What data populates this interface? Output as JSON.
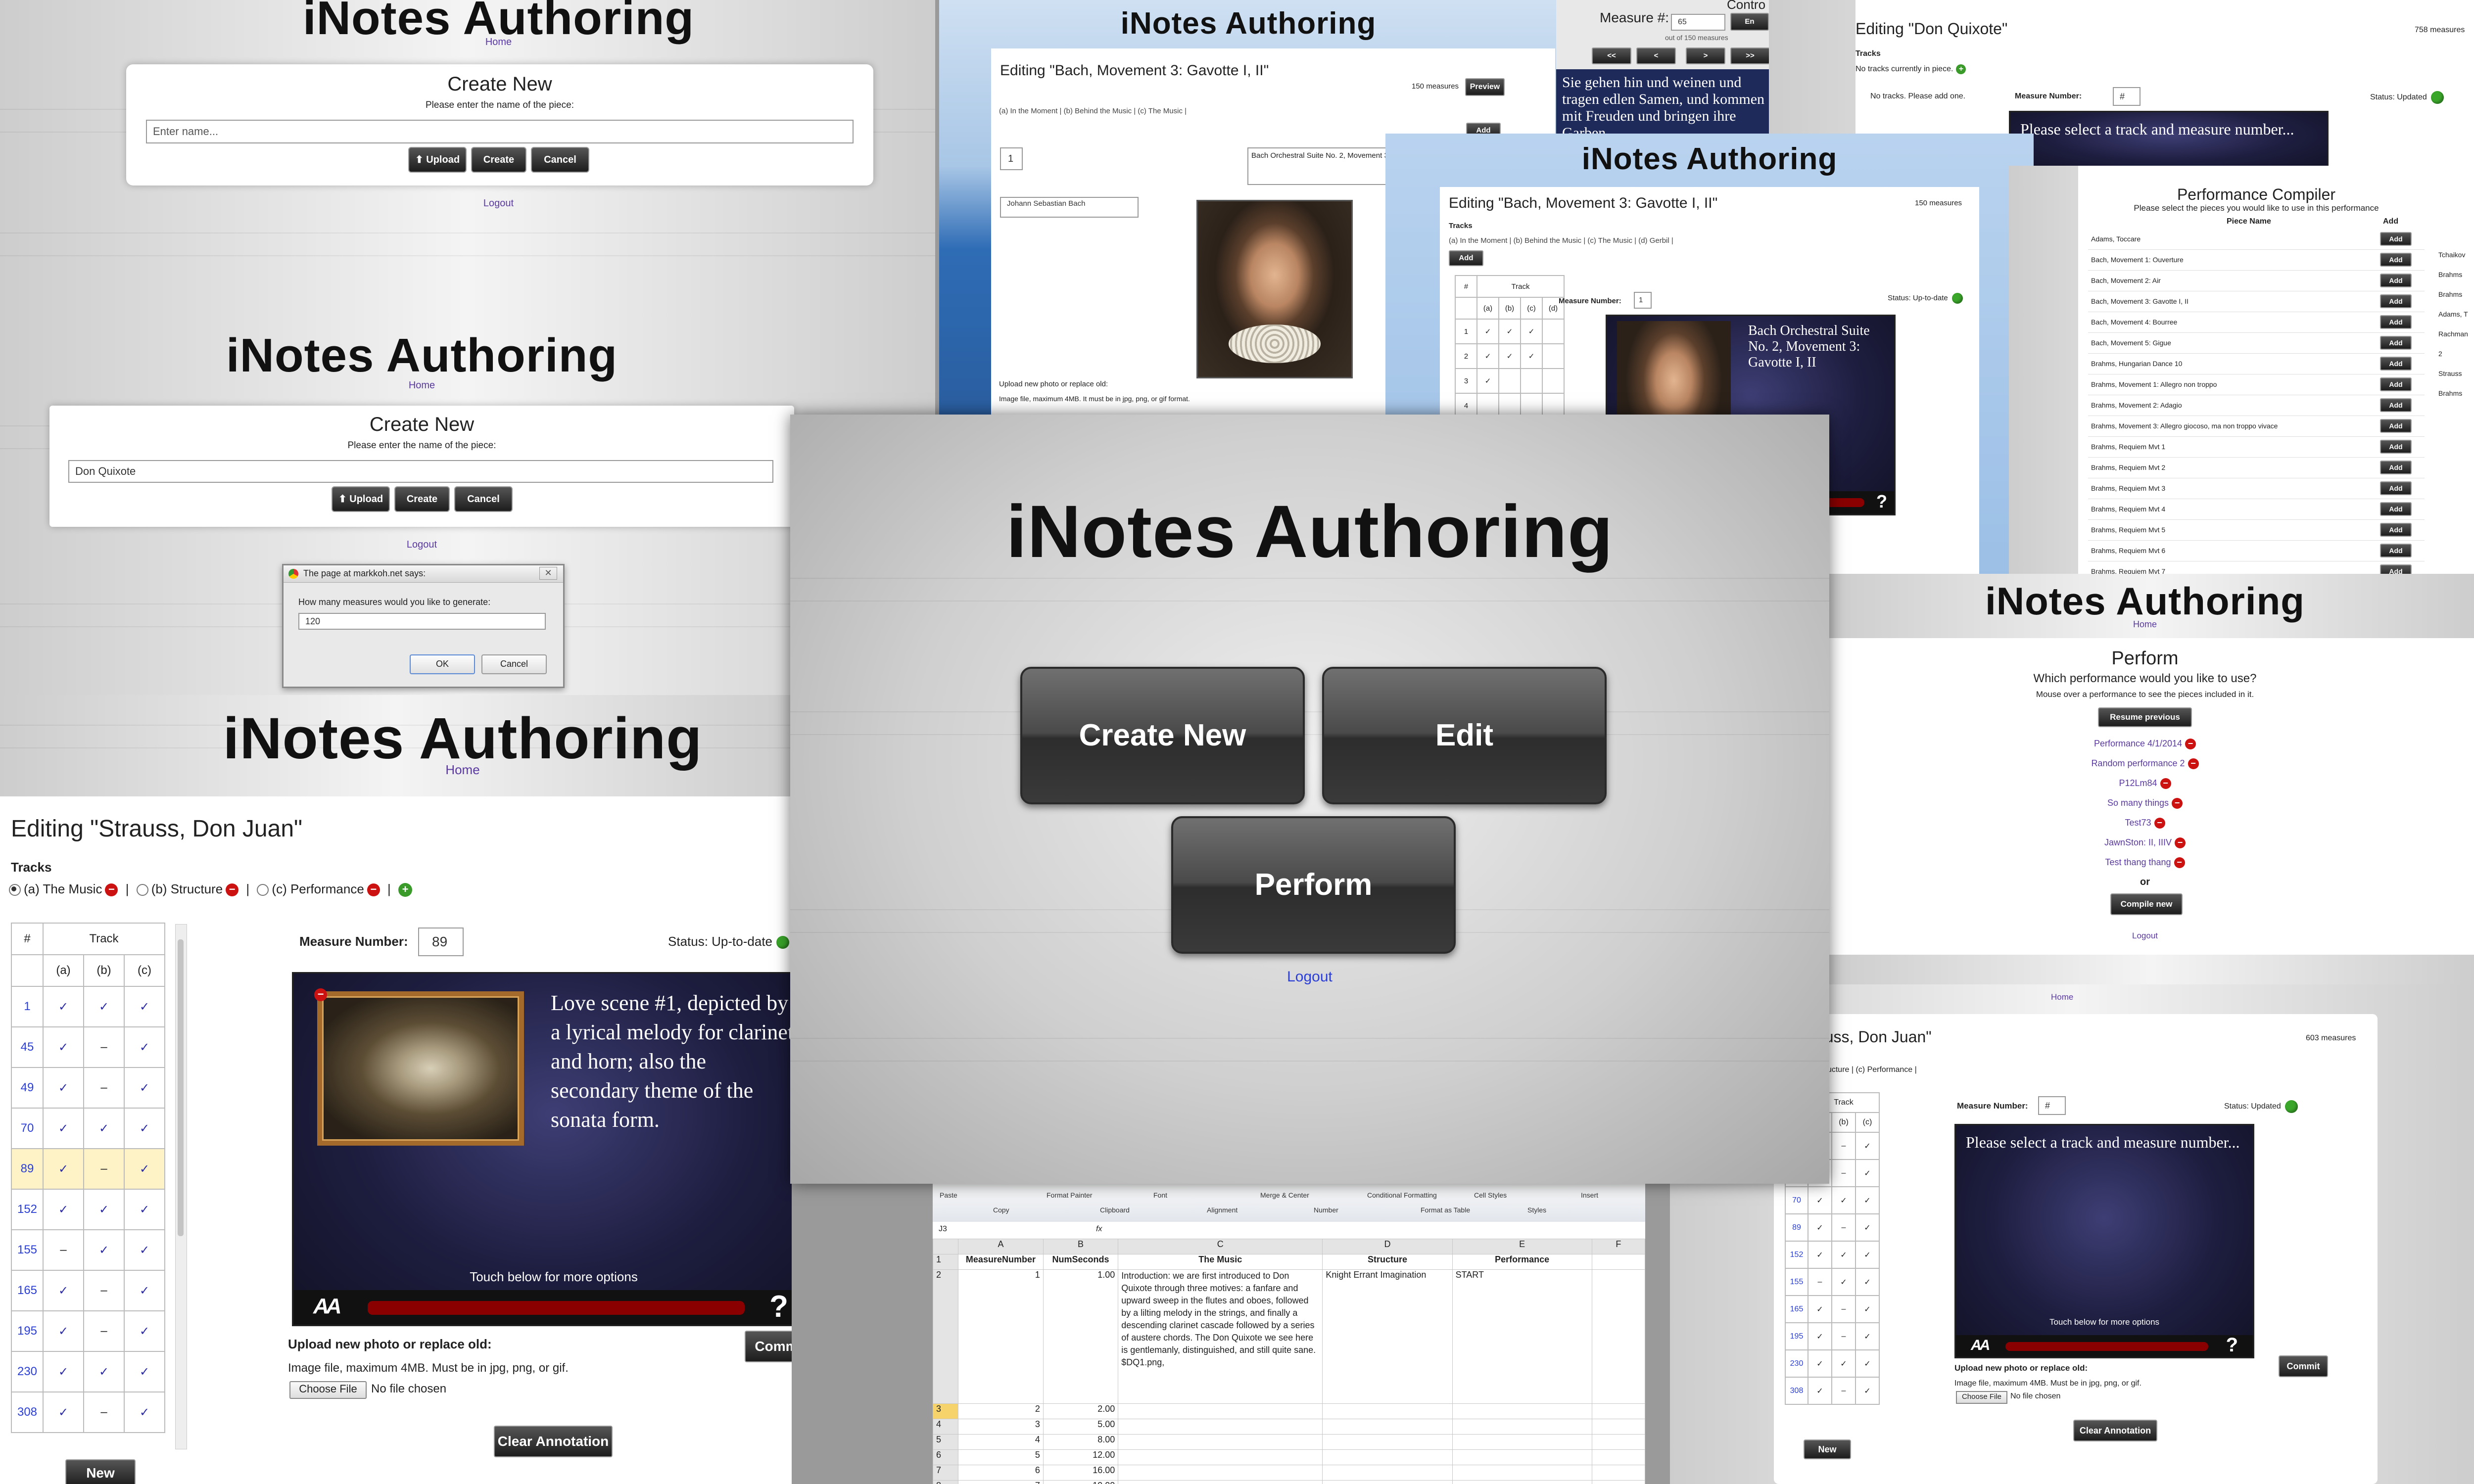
{
  "app_title": "iNotes Authoring",
  "home_link": "Home",
  "logout_link": "Logout",
  "hero": {
    "title": "iNotes Authoring",
    "create_label": "Create New",
    "edit_label": "Edit",
    "perform_label": "Perform",
    "logout": "Logout"
  },
  "create1": {
    "heading": "Create New",
    "prompt": "Please enter the name of the piece:",
    "placeholder": "Enter name...",
    "upload": "⬆ Upload",
    "create": "Create",
    "cancel": "Cancel",
    "logout": "Logout"
  },
  "create2": {
    "heading": "Create New",
    "prompt": "Please enter the name of the piece:",
    "value": "Don Quixote",
    "upload": "⬆ Upload",
    "create": "Create",
    "cancel": "Cancel",
    "logout": "Logout"
  },
  "dialog": {
    "title": "The page at markkoh.net says:",
    "question": "How many measures would you like to generate:",
    "value": "120",
    "ok": "OK",
    "cancel": "Cancel"
  },
  "bach_edit": {
    "heading": "Editing \"Bach, Movement 3: Gavotte I, II\"",
    "measures": "150 measures",
    "preview": "Preview",
    "tracks": "(a) In the Moment | (b) Behind the Music | (c) The Music |",
    "add": "Add",
    "measure_box": "1",
    "annotation_text": "Bach Orchestral Suite No. 2, Movement 3: Gavotte I, II",
    "composer": "Johann Sebastian Bach",
    "upload_label": "Upload new photo or replace old:",
    "upload_hint": "Image file, maximum 4MB. It must be in jpg, png, or gif format."
  },
  "controls": {
    "label": "Measure #:",
    "value": "65",
    "of_text": "out of 150 measures",
    "top_label": "Contro",
    "btn_en": "En",
    "first": "<<",
    "prev": "<",
    "next": ">",
    "last": ">>",
    "lyric": "Sie gehen hin und weinen und tragen edlen Samen, und kommen mit Freuden und bringen ihre Garben."
  },
  "bach_edit2": {
    "title": "iNotes Authoring",
    "heading": "Editing \"Bach, Movement 3: Gavotte I, II\"",
    "measures": "150 measures",
    "tracks_label": "Tracks",
    "tracks": "(a) In the Moment | (b) Behind the Music | (c) The Music | (d) Gerbil |",
    "add": "Add",
    "measure_label": "Measure Number:",
    "measure_value": "1",
    "status": "Status: Up-to-date",
    "track_header": "Track",
    "cols": [
      "#",
      "(a)",
      "(b)",
      "(c)",
      "(d)"
    ],
    "rows": [
      [
        "1",
        "✓",
        "✓",
        "✓",
        ""
      ],
      [
        "2",
        "✓",
        "✓",
        "✓",
        ""
      ],
      [
        "3",
        "✓",
        "",
        "",
        ""
      ],
      [
        "4",
        "",
        "",
        "",
        ""
      ]
    ],
    "annotation_text": "Bach Orchestral Suite No. 2, Movement 3: Gavotte I, II"
  },
  "quixote_edit": {
    "heading": "Editing \"Don Quixote\"",
    "measures": "758 measures",
    "tracks_label": "Tracks",
    "no_tracks": "No tracks currently in piece.",
    "no_tracks2": "No tracks. Please add one.",
    "measure_label": "Measure Number:",
    "measure_value": "#",
    "status": "Status: Updated",
    "select_msg": "Please select a track and measure number..."
  },
  "compiler": {
    "title": "Performance Compiler",
    "subtitle": "Please select the pieces you would like to use in this performance",
    "col_piece": "Piece Name",
    "col_add": "Add",
    "add_label": "Add",
    "pieces": [
      "Adams, Toccare",
      "Bach, Movement 1: Ouverture",
      "Bach, Movement 2: Air",
      "Bach, Movement 3: Gavotte I, II",
      "Bach, Movement 4: Bourree",
      "Bach, Movement 5: Gigue",
      "Brahms, Hungarian Dance 10",
      "Brahms, Movement 1: Allegro non troppo",
      "Brahms, Movement 2: Adagio",
      "Brahms, Movement 3: Allegro giocoso, ma non troppo vivace",
      "Brahms, Requiem Mvt 1",
      "Brahms, Requiem Mvt 2",
      "Brahms, Requiem Mvt 3",
      "Brahms, Requiem Mvt 4",
      "Brahms, Requiem Mvt 5",
      "Brahms, Requiem Mvt 6",
      "Brahms, Requiem Mvt 7"
    ],
    "side_list": [
      "Tchaikov",
      "Brahms",
      "Brahms",
      "Adams, T",
      "Rachman",
      "2",
      "Strauss",
      "Brahms"
    ]
  },
  "perform": {
    "title": "iNotes Authoring",
    "home": "Home",
    "heading": "Perform",
    "question": "Which performance would you like to use?",
    "hint": "Mouse over a performance to see the pieces included in it.",
    "resume": "Resume previous",
    "performances": [
      "Performance 4/1/2014",
      "Random performance 2",
      "P12Lm84",
      "So many things",
      "Test73",
      "JawnSton: II, IIIV",
      "Test thang thang"
    ],
    "or": "or",
    "compile": "Compile new",
    "logout": "Logout"
  },
  "strauss_edit": {
    "title": "iNotes Authoring",
    "home": "Home",
    "heading": "Editing \"Strauss, Don Juan\"",
    "tracks_label": "Tracks",
    "track_a": "(a) The Music",
    "track_b": "(b) Structure",
    "track_c": "(c) Performance",
    "sep": "|",
    "track_header": "Track",
    "cols": [
      "#",
      "(a)",
      "(b)",
      "(c)"
    ],
    "rows": [
      [
        "1",
        "✓",
        "✓",
        "✓"
      ],
      [
        "45",
        "✓",
        "–",
        "✓"
      ],
      [
        "49",
        "✓",
        "–",
        "✓"
      ],
      [
        "70",
        "✓",
        "✓",
        "✓"
      ],
      [
        "89",
        "✓",
        "–",
        "✓"
      ],
      [
        "152",
        "✓",
        "✓",
        "✓"
      ],
      [
        "155",
        "–",
        "✓",
        "✓"
      ],
      [
        "165",
        "✓",
        "–",
        "✓"
      ],
      [
        "195",
        "✓",
        "–",
        "✓"
      ],
      [
        "230",
        "✓",
        "✓",
        "✓"
      ],
      [
        "308",
        "✓",
        "–",
        "✓"
      ]
    ],
    "highlight_row": "89",
    "measure_label": "Measure Number:",
    "measure_value": "89",
    "status": "Status: Up-to-date",
    "annotation_text": "Love scene #1, depicted by a lyrical melody for clarinet and horn; also the secondary theme of the sonata form.",
    "touch_hint": "Touch below for more options",
    "font_icon": "AA",
    "help_icon": "?",
    "upload_label": "Upload new photo or replace old:",
    "upload_hint": "Image file, maximum 4MB. Must be in jpg, png, or gif.",
    "choose_file": "Choose File",
    "no_file": "No file chosen",
    "commit": "Commit",
    "clear": "Clear Annotation",
    "new_btn": "New"
  },
  "spreadsheet": {
    "cell_ref": "J3",
    "fx": "fx",
    "ribbon": [
      "Paste",
      "Copy",
      "Format Painter",
      "Clipboard",
      "Font",
      "Alignment",
      "Merge & Center",
      "Number",
      "Conditional Formatting",
      "Format as Table",
      "Cell Styles",
      "Styles",
      "Insert"
    ],
    "col_letters": [
      "A",
      "B",
      "C",
      "D",
      "E",
      "F"
    ],
    "headers": [
      "MeasureNumber",
      "NumSeconds",
      "The Music",
      "Structure",
      "Performance"
    ],
    "row2": {
      "measure": "1",
      "seconds": "1.00",
      "music": "Introduction: we are first introduced to Don Quixote through three motives: a fanfare and upward sweep in the flutes and oboes, followed by a lilting melody in the strings, and finally a descending clarinet cascade followed by a series of austere chords. The Don Quixote we see here is gentlemanly, distinguished, and still quite sane. $DQ1.png,",
      "structure": "Knight Errant Imagination",
      "performance": "START"
    },
    "rows": [
      [
        "3",
        "2",
        "2.00"
      ],
      [
        "4",
        "3",
        "5.00"
      ],
      [
        "5",
        "4",
        "8.00"
      ],
      [
        "6",
        "5",
        "12.00"
      ],
      [
        "7",
        "6",
        "16.00"
      ],
      [
        "8",
        "7",
        "19.00"
      ]
    ]
  },
  "strauss_small": {
    "home": "Home",
    "heading": "g \"Strauss, Don Juan\"",
    "measures": "603 measures",
    "tracks": "usic  | (b) Structure  | (c) Performance  |",
    "track_header": "Track",
    "cols": [
      "(b)",
      "(c)"
    ],
    "rows": [
      [
        "45",
        "✓",
        "–",
        "✓"
      ],
      [
        "49",
        "✓",
        "–",
        "✓"
      ],
      [
        "70",
        "✓",
        "✓",
        "✓"
      ],
      [
        "89",
        "✓",
        "–",
        "✓"
      ],
      [
        "152",
        "✓",
        "✓",
        "✓"
      ],
      [
        "155",
        "–",
        "✓",
        "✓"
      ],
      [
        "165",
        "✓",
        "–",
        "✓"
      ],
      [
        "195",
        "✓",
        "–",
        "✓"
      ],
      [
        "230",
        "✓",
        "✓",
        "✓"
      ],
      [
        "308",
        "✓",
        "–",
        "✓"
      ]
    ],
    "measure_label": "Measure Number:",
    "measure_value": "#",
    "status": "Status: Updated",
    "select_msg": "Please select a track and measure number...",
    "touch_hint": "Touch below for more options",
    "upload_label": "Upload new photo or replace old:",
    "upload_hint": "Image file, maximum 4MB. Must be in jpg, png, or gif.",
    "choose_file": "Choose File",
    "no_file": "No file chosen",
    "commit": "Commit",
    "clear": "Clear Annotation",
    "new_btn": "New"
  },
  "colors": {
    "accent_link": "#5a3aa0",
    "dark_button": "#2a2a2a",
    "annotation_bg": "#1d1d3f",
    "remove_red": "#cc1111",
    "add_green": "#3a9a2a",
    "blue_header": "#7ea6d4"
  }
}
